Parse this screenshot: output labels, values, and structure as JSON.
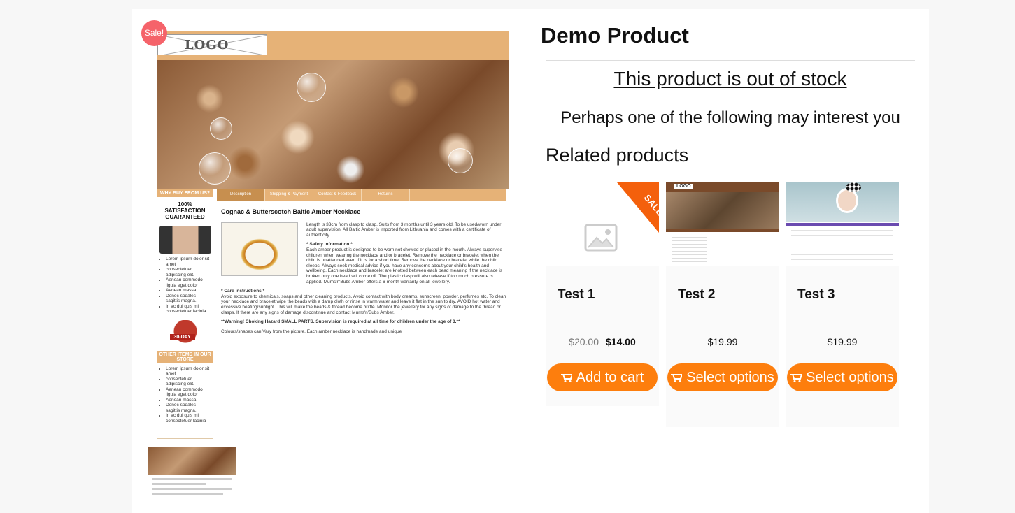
{
  "gallery": {
    "sale_badge": "Sale!",
    "logo_text": "LOGO",
    "sidebar": {
      "why_buy": "WHY BUY FROM US?",
      "guarantee": "100% SATISFACTION GUARANTEED",
      "list1": [
        "Lorem ipsum dolor sit amet",
        "consectetuer adipiscing elit.",
        "Aenean commodo ligula eget dolor",
        "Aenean massa",
        "Donec sodales sagittis magna.",
        "In ac dui quis mi consectetuer lacinia"
      ],
      "badge": "30-DAY",
      "other_items": "OTHER ITEMS IN OUR STORE",
      "list2": [
        "Lorem ipsum dolor sit amet",
        "consectetuer adipiscing elit.",
        "Aenean commodo ligula eget dolor",
        "Aenean massa",
        "Donec sodales sagittis magna.",
        "In ac dui quis mi consectetuer lacinia"
      ]
    },
    "tabs": [
      "Description",
      "Shipping & Payment",
      "Contact & Feedback",
      "Returns"
    ],
    "description": {
      "heading": "Cognac & Butterscotch Baltic Amber Necklace",
      "intro": "Length is 33cm from clasp to clasp. Suits from 3 months until 3 years old. To be used/worn under adult supervision. All Baltic Amber is imported from Lithuania and comes with a certificate of authenticity.",
      "safety_title": "* Safety Information *",
      "safety": "Each amber product is designed to be worn not chewed or placed in the mouth. Always supervise children when wearing the necklace and or bracelet. Remove the necklace or bracelet when the child is unattended even if it is for a short time. Remove the necklace or bracelet while the child sleeps. Always seek medical advice if you have any concerns about your child's health and wellbeing. Each necklace and bracelet are knotted between each bead meaning if the necklace is broken only one bead will come off. The plastic clasp will also release if too much pressure is applied. Mums'n'Bubs Amber offers a 6-month warranty on all jewellery.",
      "care_title": "* Care Instructions *",
      "care": "Avoid exposure to chemicals, soaps and other cleaning products. Avoid contact with body creams, sunscreen, powder, perfumes etc. To clean your necklace and bracelet wipe the beads with a damp cloth or rinse in warm water and leave it flat in the sun to dry. AVOID hot water and excessive heating/sunlight. This will make the beads & thread become brittle. Monitor the jewellery for any signs of damage to the thread or clasps. If there are any signs of damage discontinue and contact Mums'n'Bubs Amber.",
      "warning": "**Warning! Choking Hazard SMALL PARTS. Supervision is required at all time for children under the age of 3.**",
      "colours": "Colours/shapes can Vary from the picture. Each amber necklace is handmade and unique"
    }
  },
  "summary": {
    "title": "Demo Product",
    "out_of_stock": "This product is out of stock",
    "interest": "Perhaps one of the following may interest you",
    "related_heading": "Related products"
  },
  "related": [
    {
      "name": "Test 1",
      "sale": "SALE!",
      "old_price": "$20.00",
      "price": "$14.00",
      "button": "Add to cart",
      "image": "placeholder-icon"
    },
    {
      "name": "Test 2",
      "price": "$19.99",
      "button": "Select options",
      "image": "hammer-screenshot"
    },
    {
      "name": "Test 3",
      "price": "$19.99",
      "button": "Select options",
      "image": "girl-screenshot"
    }
  ],
  "colors": {
    "button": "#fd7e0d",
    "sale_badge": "#f5636a",
    "sale_ribbon": "#f4600c",
    "accent_tan": "#e6b277"
  }
}
